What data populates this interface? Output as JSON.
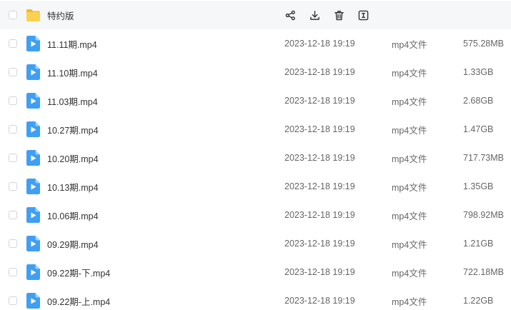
{
  "folder": {
    "name": "特约版",
    "actions": [
      {
        "name": "share-icon"
      },
      {
        "name": "download-icon"
      },
      {
        "name": "delete-icon"
      },
      {
        "name": "rename-icon"
      }
    ]
  },
  "files": [
    {
      "name": "11.11期.mp4",
      "date": "2023-12-18 19:19",
      "type": "mp4文件",
      "size": "575.28MB"
    },
    {
      "name": "11.10期.mp4",
      "date": "2023-12-18 19:19",
      "type": "mp4文件",
      "size": "1.33GB"
    },
    {
      "name": "11.03期.mp4",
      "date": "2023-12-18 19:19",
      "type": "mp4文件",
      "size": "2.68GB"
    },
    {
      "name": "10.27期.mp4",
      "date": "2023-12-18 19:19",
      "type": "mp4文件",
      "size": "1.47GB"
    },
    {
      "name": "10.20期.mp4",
      "date": "2023-12-18 19:19",
      "type": "mp4文件",
      "size": "717.73MB"
    },
    {
      "name": "10.13期.mp4",
      "date": "2023-12-18 19:19",
      "type": "mp4文件",
      "size": "1.35GB"
    },
    {
      "name": "10.06期.mp4",
      "date": "2023-12-18 19:19",
      "type": "mp4文件",
      "size": "798.92MB"
    },
    {
      "name": "09.29期.mp4",
      "date": "2023-12-18 19:19",
      "type": "mp4文件",
      "size": "1.21GB"
    },
    {
      "name": "09.22期-下.mp4",
      "date": "2023-12-18 19:19",
      "type": "mp4文件",
      "size": "722.18MB"
    },
    {
      "name": "09.22期-上.mp4",
      "date": "2023-12-18 19:19",
      "type": "mp4文件",
      "size": "1.22GB"
    }
  ],
  "colors": {
    "folder": "#f7c744",
    "video": "#4aa8f5",
    "header_bg": "#f6f7f9"
  }
}
